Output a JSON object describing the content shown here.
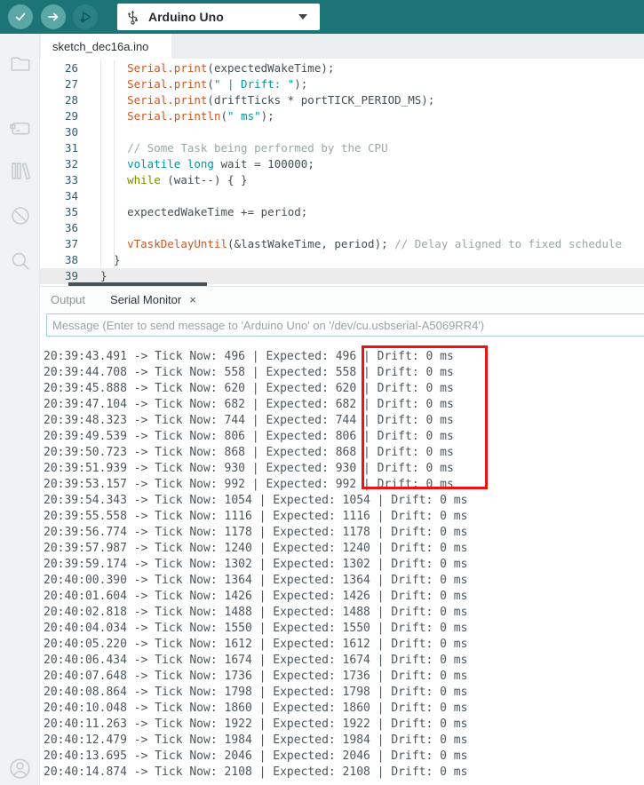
{
  "toolbar": {
    "verify_tooltip": "Verify",
    "upload_tooltip": "Upload",
    "debug_tooltip": "Start Debugging",
    "board_selector": {
      "value": "Arduino Uno"
    }
  },
  "sidebar": {
    "items": [
      "sketchbook",
      "boards-manager",
      "library-manager",
      "debug",
      "search"
    ],
    "account": "account"
  },
  "editor": {
    "tab_title": "sketch_dec16a.ino",
    "lines": [
      {
        "num": 26,
        "segs": [
          [
            "d",
            "    "
          ],
          [
            "o",
            "Serial.print"
          ],
          [
            "d",
            "("
          ],
          [
            "d",
            "expectedWakeTime"
          ],
          [
            "d",
            ");"
          ]
        ]
      },
      {
        "num": 27,
        "segs": [
          [
            "d",
            "    "
          ],
          [
            "o",
            "Serial.print"
          ],
          [
            "d",
            "("
          ],
          [
            "s",
            "\" | Drift: \""
          ],
          [
            "d",
            ");"
          ]
        ]
      },
      {
        "num": 28,
        "segs": [
          [
            "d",
            "    "
          ],
          [
            "o",
            "Serial.print"
          ],
          [
            "d",
            "("
          ],
          [
            "d",
            "driftTicks * portTICK_PERIOD_MS"
          ],
          [
            "d",
            ");"
          ]
        ]
      },
      {
        "num": 29,
        "segs": [
          [
            "d",
            "    "
          ],
          [
            "o",
            "Serial.println"
          ],
          [
            "d",
            "("
          ],
          [
            "s",
            "\" ms\""
          ],
          [
            "d",
            ");"
          ]
        ]
      },
      {
        "num": 30,
        "segs": []
      },
      {
        "num": 31,
        "segs": [
          [
            "d",
            "    "
          ],
          [
            "c",
            "// Some Task being performed by the CPU"
          ]
        ]
      },
      {
        "num": 32,
        "segs": [
          [
            "d",
            "    "
          ],
          [
            "k",
            "volatile long"
          ],
          [
            "d",
            " wait = "
          ],
          [
            "d",
            "100000"
          ],
          [
            "d",
            ";"
          ]
        ]
      },
      {
        "num": 33,
        "segs": [
          [
            "d",
            "    "
          ],
          [
            "g",
            "while"
          ],
          [
            "d",
            " (wait--) { }"
          ]
        ]
      },
      {
        "num": 34,
        "segs": []
      },
      {
        "num": 35,
        "segs": [
          [
            "d",
            "    "
          ],
          [
            "d",
            "expectedWakeTime += period;"
          ]
        ]
      },
      {
        "num": 36,
        "segs": []
      },
      {
        "num": 37,
        "segs": [
          [
            "d",
            "    "
          ],
          [
            "o",
            "vTaskDelayUntil"
          ],
          [
            "d",
            "(&lastWakeTime, period); "
          ],
          [
            "c",
            "// Delay aligned to fixed schedule"
          ]
        ]
      },
      {
        "num": 38,
        "segs": [
          [
            "d",
            "  }"
          ]
        ]
      },
      {
        "num": 39,
        "segs": [
          [
            "d",
            "}"
          ]
        ],
        "highlight": true
      }
    ]
  },
  "panel": {
    "tabs": [
      {
        "label": "Output",
        "active": false
      },
      {
        "label": "Serial Monitor",
        "active": true,
        "close_icon": "×"
      }
    ],
    "message_input": {
      "value": "",
      "placeholder": "Message (Enter to send message to 'Arduino Uno' on '/dev/cu.usbserial-A5069RR4')"
    },
    "serial": {
      "line_template": "{time} -> Tick Now: {tick} | Expected: {expected} | Drift: {drift} ms",
      "lines": [
        {
          "time": "20:39:43.491",
          "tick": 496,
          "expected": 496,
          "drift": 0
        },
        {
          "time": "20:39:44.708",
          "tick": 558,
          "expected": 558,
          "drift": 0
        },
        {
          "time": "20:39:45.888",
          "tick": 620,
          "expected": 620,
          "drift": 0
        },
        {
          "time": "20:39:47.104",
          "tick": 682,
          "expected": 682,
          "drift": 0
        },
        {
          "time": "20:39:48.323",
          "tick": 744,
          "expected": 744,
          "drift": 0
        },
        {
          "time": "20:39:49.539",
          "tick": 806,
          "expected": 806,
          "drift": 0
        },
        {
          "time": "20:39:50.723",
          "tick": 868,
          "expected": 868,
          "drift": 0
        },
        {
          "time": "20:39:51.939",
          "tick": 930,
          "expected": 930,
          "drift": 0
        },
        {
          "time": "20:39:53.157",
          "tick": 992,
          "expected": 992,
          "drift": 0
        },
        {
          "time": "20:39:54.343",
          "tick": 1054,
          "expected": 1054,
          "drift": 0
        },
        {
          "time": "20:39:55.558",
          "tick": 1116,
          "expected": 1116,
          "drift": 0
        },
        {
          "time": "20:39:56.774",
          "tick": 1178,
          "expected": 1178,
          "drift": 0
        },
        {
          "time": "20:39:57.987",
          "tick": 1240,
          "expected": 1240,
          "drift": 0
        },
        {
          "time": "20:39:59.174",
          "tick": 1302,
          "expected": 1302,
          "drift": 0
        },
        {
          "time": "20:40:00.390",
          "tick": 1364,
          "expected": 1364,
          "drift": 0
        },
        {
          "time": "20:40:01.604",
          "tick": 1426,
          "expected": 1426,
          "drift": 0
        },
        {
          "time": "20:40:02.818",
          "tick": 1488,
          "expected": 1488,
          "drift": 0
        },
        {
          "time": "20:40:04.034",
          "tick": 1550,
          "expected": 1550,
          "drift": 0
        },
        {
          "time": "20:40:05.220",
          "tick": 1612,
          "expected": 1612,
          "drift": 0
        },
        {
          "time": "20:40:06.434",
          "tick": 1674,
          "expected": 1674,
          "drift": 0
        },
        {
          "time": "20:40:07.648",
          "tick": 1736,
          "expected": 1736,
          "drift": 0
        },
        {
          "time": "20:40:08.864",
          "tick": 1798,
          "expected": 1798,
          "drift": 0
        },
        {
          "time": "20:40:10.048",
          "tick": 1860,
          "expected": 1860,
          "drift": 0
        },
        {
          "time": "20:40:11.263",
          "tick": 1922,
          "expected": 1922,
          "drift": 0
        },
        {
          "time": "20:40:12.479",
          "tick": 1984,
          "expected": 1984,
          "drift": 0
        },
        {
          "time": "20:40:13.695",
          "tick": 2046,
          "expected": 2046,
          "drift": 0
        },
        {
          "time": "20:40:14.874",
          "tick": 2108,
          "expected": 2108,
          "drift": 0
        }
      ]
    }
  },
  "annotation": {
    "type": "red-box",
    "highlights": "Drift: 0 ms column of first 9 serial lines"
  }
}
